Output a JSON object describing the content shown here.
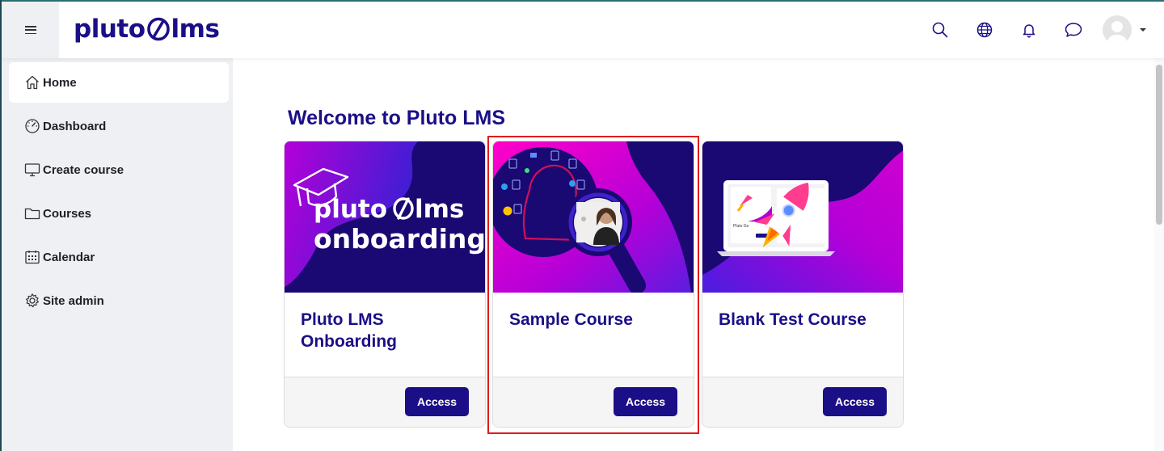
{
  "header": {
    "logo_left": "pluto",
    "logo_right": "lms",
    "icons": [
      "menu-icon",
      "search-icon",
      "globe-icon",
      "bell-icon",
      "chat-icon",
      "avatar",
      "caret-down-icon"
    ]
  },
  "sidebar": {
    "items": [
      {
        "label": "Home",
        "icon": "home-icon"
      },
      {
        "label": "Dashboard",
        "icon": "gauge-icon"
      },
      {
        "label": "Create course",
        "icon": "monitor-icon"
      },
      {
        "label": "Courses",
        "icon": "folder-icon"
      },
      {
        "label": "Calendar",
        "icon": "calendar-icon"
      },
      {
        "label": "Site admin",
        "icon": "gear-icon"
      }
    ]
  },
  "main": {
    "welcome": "Welcome to Pluto LMS",
    "courses": [
      {
        "title": "Pluto LMS Onboarding",
        "banner_line1_left": "pluto",
        "banner_line1_right": "lms",
        "banner_line2": "onboarding",
        "button": "Access"
      },
      {
        "title": "Sample Course",
        "button": "Access"
      },
      {
        "title": "Blank Test Course",
        "mini_label": "Pluto Go",
        "button": "Access"
      }
    ]
  },
  "colors": {
    "brand": "#1b0f87",
    "magenta": "#c300d6",
    "highlight": "#e01b1b",
    "sidebar_bg": "#eef0f3"
  }
}
